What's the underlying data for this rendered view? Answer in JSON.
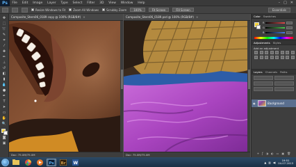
{
  "app": {
    "logo": "Ps",
    "menu": [
      "File",
      "Edit",
      "Image",
      "Layer",
      "Type",
      "Select",
      "Filter",
      "3D",
      "View",
      "Window",
      "Help"
    ],
    "window_controls": [
      "–",
      "□",
      "✕"
    ]
  },
  "options_bar": {
    "resize_windows_label": "Resize Windows to Fit",
    "zoom_all_windows_label": "Zoom All Windows",
    "scrubby_zoom_label": "Scrubby Zoom",
    "btn_100": "100%",
    "btn_fit": "Fit Screen",
    "btn_fill": "Fill Screen",
    "workspace": "Essentials"
  },
  "documents": [
    {
      "tab_title": "Composite_Stern06_0189 copy @ 100% (RGB/8#)",
      "status": "Doc: 75.0M/75.0M"
    },
    {
      "tab_title": "Composite_Stern06_0189.psd @ 100% (RGB/8#)",
      "status": "Doc: 75.0M/75.0M"
    }
  ],
  "panels": {
    "color_tabs": [
      "Color",
      "Swatches"
    ],
    "sliders": [
      {
        "label": "R",
        "value": "",
        "color": "#e34b4b"
      },
      {
        "label": "G",
        "value": "",
        "color": "#4bc94b"
      },
      {
        "label": "B",
        "value": "",
        "color": "#4b7de3"
      }
    ],
    "adjust_tabs": [
      "Adjustments",
      "Styles"
    ],
    "adjust_title": "Add an adjustment",
    "layers_tabs": [
      "Layers",
      "Channels",
      "Paths"
    ],
    "layer_name": "Background"
  },
  "taskbar": {
    "time": "19:51",
    "date": "04.07.2013"
  }
}
